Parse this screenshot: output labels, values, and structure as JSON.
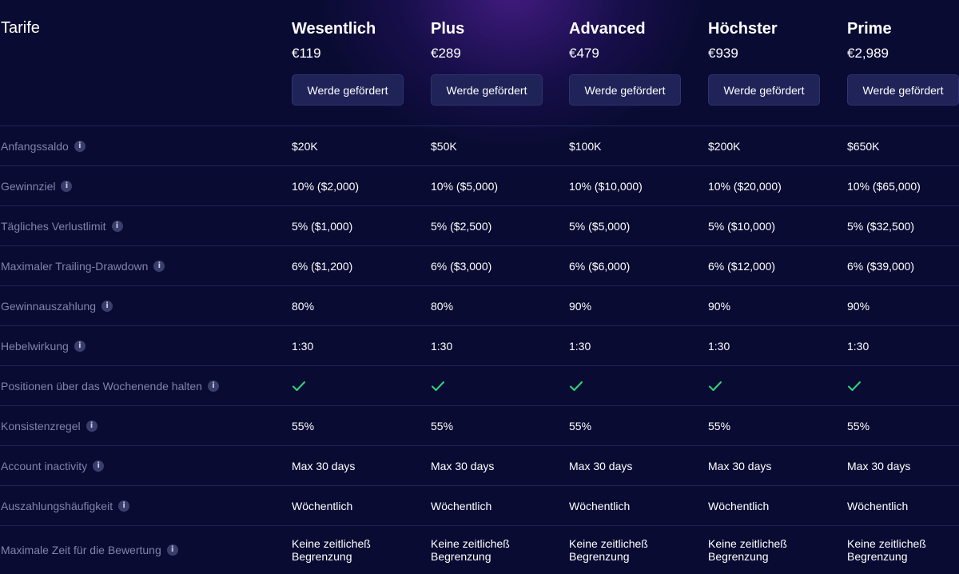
{
  "header": {
    "title": "Tarife"
  },
  "plans": [
    {
      "name": "Wesentlich",
      "price": "€119",
      "cta": "Werde gefördert"
    },
    {
      "name": "Plus",
      "price": "€289",
      "cta": "Werde gefördert"
    },
    {
      "name": "Advanced",
      "price": "€479",
      "cta": "Werde gefördert"
    },
    {
      "name": "Höchster",
      "price": "€939",
      "cta": "Werde gefördert"
    },
    {
      "name": "Prime",
      "price": "€2,989",
      "cta": "Werde gefördert"
    }
  ],
  "info_glyph": "i",
  "rows": [
    {
      "label": "Anfangssaldo",
      "values": [
        "$20K",
        "$50K",
        "$100K",
        "$200K",
        "$650K"
      ]
    },
    {
      "label": "Gewinnziel",
      "values": [
        "10% ($2,000)",
        "10% ($5,000)",
        "10% ($10,000)",
        "10% ($20,000)",
        "10% ($65,000)"
      ]
    },
    {
      "label": "Tägliches Verlustlimit",
      "values": [
        "5% ($1,000)",
        "5% ($2,500)",
        "5% ($5,000)",
        "5% ($10,000)",
        "5% ($32,500)"
      ]
    },
    {
      "label": "Maximaler Trailing-Drawdown",
      "values": [
        "6% ($1,200)",
        "6% ($3,000)",
        "6% ($6,000)",
        "6% ($12,000)",
        "6% ($39,000)"
      ]
    },
    {
      "label": "Gewinnauszahlung",
      "values": [
        "80%",
        "80%",
        "90%",
        "90%",
        "90%"
      ]
    },
    {
      "label": "Hebelwirkung",
      "values": [
        "1:30",
        "1:30",
        "1:30",
        "1:30",
        "1:30"
      ]
    },
    {
      "label": "Positionen über das Wochenende halten",
      "values": [
        "",
        "",
        "",
        "",
        ""
      ],
      "icon": "check-icon"
    },
    {
      "label": "Konsistenzregel",
      "values": [
        "55%",
        "55%",
        "55%",
        "55%",
        "55%"
      ]
    },
    {
      "label": "Account inactivity",
      "values": [
        "Max 30 days",
        "Max 30 days",
        "Max 30 days",
        "Max 30 days",
        "Max 30 days"
      ]
    },
    {
      "label": "Auszahlungshäufigkeit",
      "values": [
        "Wöchentlich",
        "Wöchentlich",
        "Wöchentlich",
        "Wöchentlich",
        "Wöchentlich"
      ]
    },
    {
      "label": "Maximale Zeit für die Bewertung",
      "values": [
        "Keine zeitlicheß Begrenzung",
        "Keine zeitlicheß Begrenzung",
        "Keine zeitlicheß Begrenzung",
        "Keine zeitlicheß Begrenzung",
        "Keine zeitlicheß Begrenzung"
      ]
    }
  ],
  "colors": {
    "background": "#0a0b33",
    "button": "#1f2358",
    "label": "#7f84ac",
    "check": "#2fd67b",
    "divider": "#20245a"
  }
}
